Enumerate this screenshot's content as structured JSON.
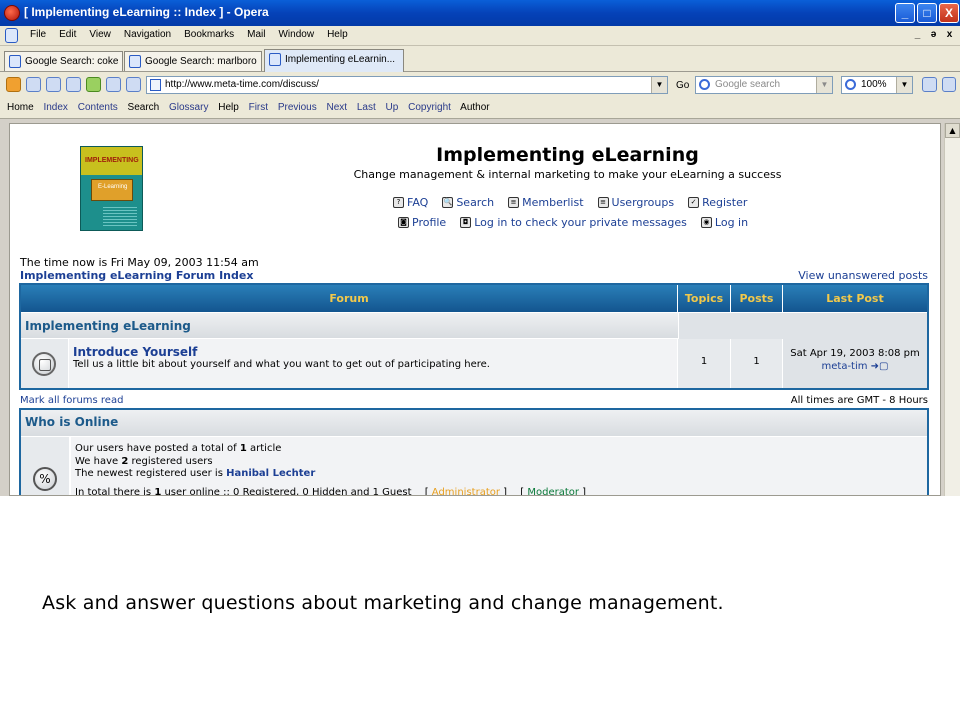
{
  "window": {
    "title": "[ Implementing eLearning :: Index ] - Opera",
    "min": "_",
    "max": "□",
    "close": "X"
  },
  "menu": [
    "File",
    "Edit",
    "View",
    "Navigation",
    "Bookmarks",
    "Mail",
    "Window",
    "Help"
  ],
  "mdi": [
    "_",
    "ǝ",
    "x"
  ],
  "tabs": [
    {
      "label": "Google Search: coke"
    },
    {
      "label": "Google Search: marlboro"
    },
    {
      "label": "Implementing eLearnin..."
    }
  ],
  "address": {
    "url": "http://www.meta-time.com/discuss/",
    "go": "Go",
    "search_placeholder": "Google search",
    "zoom": "100%"
  },
  "navbar": [
    "Home",
    "Index",
    "Contents",
    "Search",
    "Glossary",
    "Help",
    "First",
    "Previous",
    "Next",
    "Last",
    "Up",
    "Copyright",
    "Author"
  ],
  "site": {
    "title": "Implementing eLearning",
    "description": "Change management & internal marketing to make your eLearning a success",
    "logo_top": "IMPLEMENTING",
    "logo_mid": "E-Learning"
  },
  "links_row1": [
    {
      "icon": "?",
      "label": "FAQ"
    },
    {
      "icon": "🔍",
      "label": "Search"
    },
    {
      "icon": "≡",
      "label": "Memberlist"
    },
    {
      "icon": "≡",
      "label": "Usergroups"
    },
    {
      "icon": "✓",
      "label": "Register"
    }
  ],
  "links_row2": [
    {
      "icon": "◙",
      "label": "Profile"
    },
    {
      "icon": "◘",
      "label": "Log in to check your private messages"
    },
    {
      "icon": "◉",
      "label": "Log in"
    }
  ],
  "time_text": "The time now is Fri May 09, 2003 11:54 am",
  "forum_index_link": "Implementing eLearning Forum Index",
  "unanswered_link": "View unanswered posts",
  "forum_table": {
    "headers": [
      "Forum",
      "Topics",
      "Posts",
      "Last Post"
    ],
    "category": "Implementing eLearning",
    "rows": [
      {
        "name": "Introduce Yourself",
        "description": "Tell us a little bit about yourself and what you want to get out of participating here.",
        "topics": "1",
        "posts": "1",
        "last_post_date": "Sat Apr 19, 2003 8:08 pm",
        "last_post_user": "meta-tim ➜▢"
      }
    ]
  },
  "mark_read": "Mark all forums read",
  "times_gmt": "All times are GMT - 8 Hours",
  "online": {
    "title": "Who is Online",
    "line1_pre": "Our users have posted a total of ",
    "line1_num": "1",
    "line1_post": " article",
    "line2_pre": "We have ",
    "line2_num": "2",
    "line2_post": " registered users",
    "line3_pre": "The newest registered user is ",
    "line3_user": "Hanibal Lechter",
    "line4_pre": "In total there is ",
    "line4_num": "1",
    "line4_post": " user online :: 0 Registered, 0 Hidden and 1 Guest",
    "admin_open": "[ ",
    "admin": "Administrator",
    "admin_close": " ]",
    "mod_open": "[ ",
    "mod": "Moderator",
    "mod_close": " ]"
  },
  "caption": "Ask and answer questions about marketing and change management.",
  "colors": {
    "table_border": "#1e67a0",
    "header_text": "#f3c94a",
    "link": "#1c3f94",
    "admin": "#e8a020",
    "moderator": "#0b7a3a"
  }
}
